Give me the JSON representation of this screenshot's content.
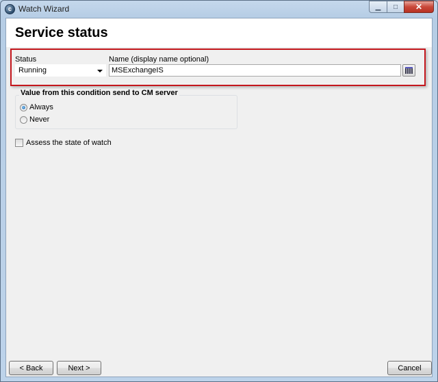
{
  "window": {
    "title": "Watch Wizard",
    "app_icon": "c-logo-icon",
    "controls": {
      "minimize": "minimize-icon",
      "maximize": "maximize-icon",
      "close": "close-icon"
    }
  },
  "page": {
    "title": "Service status"
  },
  "service": {
    "status_label": "Status",
    "status_value": "Running",
    "name_label": "Name (display name optional)",
    "name_value": "MSExchangeIS",
    "browse_icon": "grid-list-icon"
  },
  "send_group": {
    "title": "Value from this condition send to CM server",
    "options": [
      {
        "label": "Always",
        "selected": true
      },
      {
        "label": "Never",
        "selected": false
      }
    ]
  },
  "assess": {
    "label": "Assess the state of watch",
    "checked": false
  },
  "footer": {
    "back_label": "< Back",
    "next_label": "Next >",
    "cancel_label": "Cancel"
  },
  "colors": {
    "highlight_border": "#c4161c",
    "radio_selected": "#1c5fa8"
  }
}
